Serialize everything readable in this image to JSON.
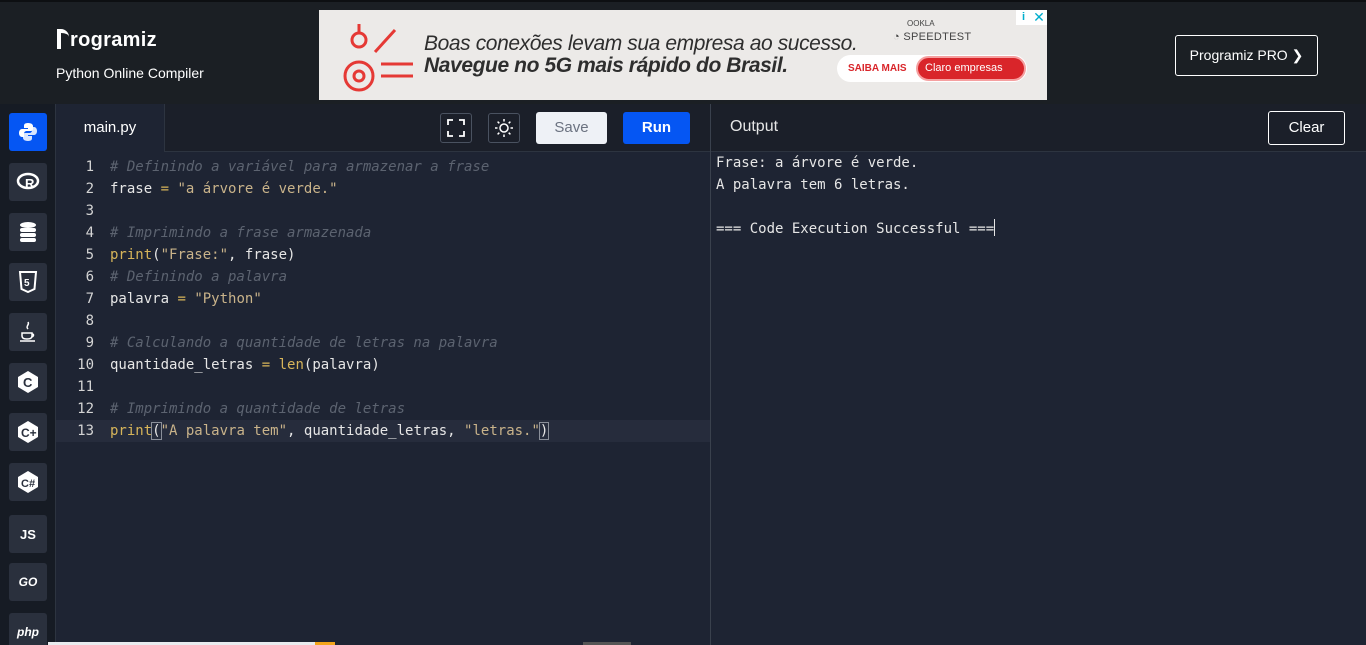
{
  "header": {
    "logo_text": "rogramiz",
    "subtitle": "Python Online Compiler",
    "pro_button": "Programiz PRO ❯"
  },
  "ad": {
    "line1": "Boas conexões levam sua empresa ao sucesso.",
    "line2": "Navegue no 5G mais rápido do Brasil.",
    "ookla": "OOKLA",
    "speedtest": "SPEEDTEST",
    "saiba": "SAIBA MAIS",
    "claro": "Claro empresas",
    "info": "i",
    "close": "✕"
  },
  "sidebar": {
    "items": [
      {
        "name": "python",
        "label": ""
      },
      {
        "name": "r",
        "label": "R"
      },
      {
        "name": "sql",
        "label": ""
      },
      {
        "name": "html",
        "label": "5"
      },
      {
        "name": "java",
        "label": ""
      },
      {
        "name": "c",
        "label": "C"
      },
      {
        "name": "cpp",
        "label": "C+"
      },
      {
        "name": "csharp",
        "label": "C#"
      },
      {
        "name": "js",
        "label": "JS"
      },
      {
        "name": "go",
        "label": "GO"
      },
      {
        "name": "php",
        "label": "php"
      }
    ]
  },
  "editor": {
    "tab": "main.py",
    "save": "Save",
    "run": "Run",
    "lines": [
      {
        "n": "1",
        "html": "<span class='cm'># Definindo a variável para armazenar a frase</span>"
      },
      {
        "n": "2",
        "html": "<span class='id'>frase</span> <span class='op'>=</span> <span class='st'>\"a árvore é verde.\"</span>"
      },
      {
        "n": "3",
        "html": ""
      },
      {
        "n": "4",
        "html": "<span class='cm'># Imprimindo a frase armazenada</span>"
      },
      {
        "n": "5",
        "html": "<span class='fn'>print</span><span class='id'>(</span><span class='st'>\"Frase:\"</span><span class='id'>, frase)</span>"
      },
      {
        "n": "6",
        "html": "<span class='cm'># Definindo a palavra</span>"
      },
      {
        "n": "7",
        "html": "<span class='id'>palavra</span> <span class='op'>=</span> <span class='st'>\"Python\"</span>"
      },
      {
        "n": "8",
        "html": ""
      },
      {
        "n": "9",
        "html": "<span class='cm'># Calculando a quantidade de letras na palavra</span>"
      },
      {
        "n": "10",
        "html": "<span class='id'>quantidade_letras</span> <span class='op'>=</span> <span class='fn'>len</span><span class='id'>(palavra)</span>"
      },
      {
        "n": "11",
        "html": ""
      },
      {
        "n": "12",
        "html": "<span class='cm'># Imprimindo a quantidade de letras</span>"
      },
      {
        "n": "13",
        "html": "<span class='fn'>print</span><span class='id br'>(</span><span class='st'>\"A palavra tem\"</span><span class='id'>, quantidade_letras, </span><span class='st'>\"letras.\"</span><span class='id br'>)</span>"
      }
    ],
    "active_line": 13
  },
  "output": {
    "title": "Output",
    "clear": "Clear",
    "lines": [
      "Frase: a árvore é verde.",
      "A palavra tem 6 letras.",
      "",
      "=== Code Execution Successful ==="
    ]
  }
}
